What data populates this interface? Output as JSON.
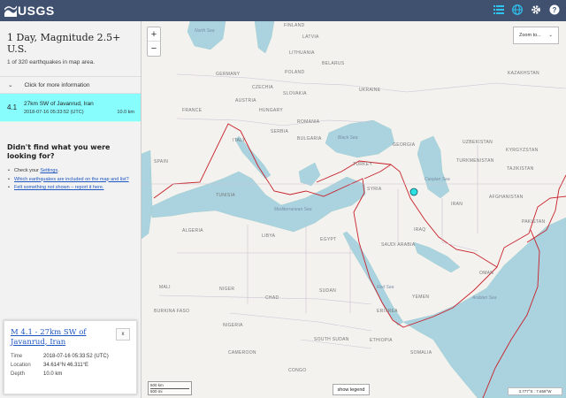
{
  "header": {
    "logo_text": "USGS",
    "icons": [
      "list-icon",
      "globe-icon",
      "gear-icon",
      "help-icon"
    ],
    "colors": {
      "bar": "#405170",
      "accent": "#2ec4f0"
    }
  },
  "summary": {
    "title": "1 Day, Magnitude 2.5+ U.S.",
    "count_text": "1 of 320 earthquakes in map area.",
    "more_info_label": "Click for more information"
  },
  "earthquake": {
    "magnitude": "4.1",
    "place": "27km SW of Javanrud, Iran",
    "time": "2018-07-16 05:33:52 (UTC)",
    "depth": "10.0 km",
    "highlight_color": "#87fdfd"
  },
  "help": {
    "title": "Didn't find what you were looking for?",
    "item1_prefix": "Check your ",
    "item1_link": "Settings",
    "item1_suffix": ".",
    "item2": "Which earthquakes are included on the map and list?",
    "item3": "Felt something not shown – report it here."
  },
  "map": {
    "zoom_in": "+",
    "zoom_out": "−",
    "zoom_to_label": "Zoom to...",
    "show_legend_label": "show legend",
    "coords_text": "3.777°S : 7.658°W",
    "scale": {
      "km": "500 km",
      "mi": "500 mi"
    },
    "countries": [
      "FINLAND",
      "LATVIA",
      "LITHUANIA",
      "BELARUS",
      "UKRAINE",
      "KAZAKHSTAN",
      "GERMANY",
      "POLAND",
      "CZECHIA",
      "SLOVAKIA",
      "AUSTRIA",
      "HUNGARY",
      "FRANCE",
      "ROMANIA",
      "SERBIA",
      "BULGARIA",
      "ITALY",
      "GEORGIA",
      "UZBEKISTAN",
      "KYRGYZSTAN",
      "SPAIN",
      "TURKEY",
      "TURKMENISTAN",
      "TAJIKISTAN",
      "TUNISIA",
      "SYRIA",
      "IRAN",
      "AFGHANISTAN",
      "ALGERIA",
      "LIBYA",
      "EGYPT",
      "SAUDI ARABIA",
      "PAKISTAN",
      "MALI",
      "NIGER",
      "CHAD",
      "SUDAN",
      "ERITREA",
      "YEMEN",
      "BURKINA FASO",
      "NIGERIA",
      "ETHIOPIA",
      "CAMEROON",
      "SOUTH SUDAN",
      "SOMALIA",
      "IRAQ",
      "OMAN",
      "CONGO"
    ],
    "seas": [
      "Black Sea",
      "Caspian Sea",
      "Mediterranean Sea",
      "Red Sea",
      "Arabian Sea",
      "North Sea"
    ]
  },
  "popup": {
    "title": "M 4.1 - 27km SW of Javanrud, Iran",
    "close_label": "x",
    "time_label": "Time",
    "time_value": "2018-07-16 05:33:52 (UTC)",
    "location_label": "Location",
    "location_value": "34.614°N 46.311°E",
    "depth_label": "Depth",
    "depth_value": "10.0 km"
  }
}
